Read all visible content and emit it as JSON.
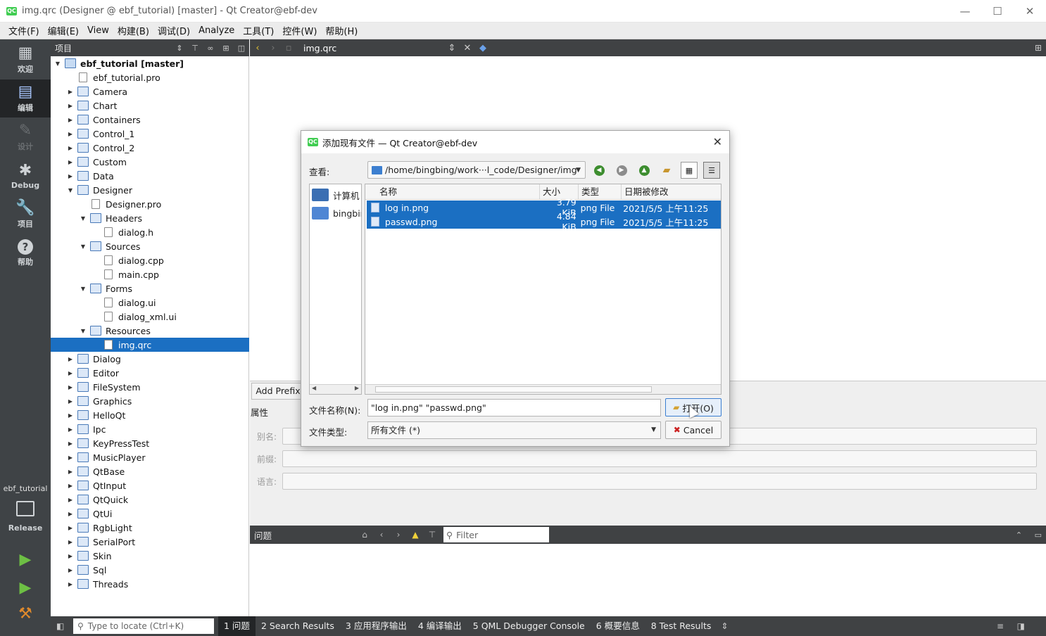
{
  "window": {
    "title": "img.qrc (Designer @ ebf_tutorial) [master] - Qt Creator@ebf-dev",
    "logo": "QC",
    "controls": [
      "minimize-icon",
      "maximize-icon",
      "close-icon"
    ]
  },
  "menu": [
    "文件(F)",
    "编辑(E)",
    "View",
    "构建(B)",
    "调试(D)",
    "Analyze",
    "工具(T)",
    "控件(W)",
    "帮助(H)"
  ],
  "modes": [
    {
      "label": "欢迎",
      "icon": "grid-icon",
      "state": "normal"
    },
    {
      "label": "编辑",
      "icon": "edit-doc-icon",
      "state": "active"
    },
    {
      "label": "设计",
      "icon": "pencil-icon",
      "state": "disabled"
    },
    {
      "label": "Debug",
      "icon": "bug-icon",
      "state": "normal"
    },
    {
      "label": "项目",
      "icon": "wrench-icon",
      "state": "normal"
    },
    {
      "label": "帮助",
      "icon": "help-icon",
      "state": "normal"
    }
  ],
  "kit": {
    "name": "ebf_tutorial",
    "build": "Release"
  },
  "project_panel": {
    "title": "项目",
    "tree": [
      {
        "label": "ebf_tutorial [master]",
        "depth": 0,
        "arrow": "open",
        "kind": "root"
      },
      {
        "label": "ebf_tutorial.pro",
        "depth": 1,
        "arrow": "none",
        "kind": "file"
      },
      {
        "label": "Camera",
        "depth": 1,
        "arrow": "closed",
        "kind": "folder"
      },
      {
        "label": "Chart",
        "depth": 1,
        "arrow": "closed",
        "kind": "folder"
      },
      {
        "label": "Containers",
        "depth": 1,
        "arrow": "closed",
        "kind": "folder"
      },
      {
        "label": "Control_1",
        "depth": 1,
        "arrow": "closed",
        "kind": "folder"
      },
      {
        "label": "Control_2",
        "depth": 1,
        "arrow": "closed",
        "kind": "folder"
      },
      {
        "label": "Custom",
        "depth": 1,
        "arrow": "closed",
        "kind": "folder"
      },
      {
        "label": "Data",
        "depth": 1,
        "arrow": "closed",
        "kind": "folder"
      },
      {
        "label": "Designer",
        "depth": 1,
        "arrow": "open",
        "kind": "folder"
      },
      {
        "label": "Designer.pro",
        "depth": 2,
        "arrow": "none",
        "kind": "file"
      },
      {
        "label": "Headers",
        "depth": 2,
        "arrow": "open",
        "kind": "folder"
      },
      {
        "label": "dialog.h",
        "depth": 3,
        "arrow": "none",
        "kind": "file"
      },
      {
        "label": "Sources",
        "depth": 2,
        "arrow": "open",
        "kind": "folder"
      },
      {
        "label": "dialog.cpp",
        "depth": 3,
        "arrow": "none",
        "kind": "file"
      },
      {
        "label": "main.cpp",
        "depth": 3,
        "arrow": "none",
        "kind": "file"
      },
      {
        "label": "Forms",
        "depth": 2,
        "arrow": "open",
        "kind": "folder"
      },
      {
        "label": "dialog.ui",
        "depth": 3,
        "arrow": "none",
        "kind": "file"
      },
      {
        "label": "dialog_xml.ui",
        "depth": 3,
        "arrow": "none",
        "kind": "file"
      },
      {
        "label": "Resources",
        "depth": 2,
        "arrow": "open",
        "kind": "folder"
      },
      {
        "label": "img.qrc",
        "depth": 3,
        "arrow": "none",
        "kind": "file",
        "selected": true
      },
      {
        "label": "Dialog",
        "depth": 1,
        "arrow": "closed",
        "kind": "folder"
      },
      {
        "label": "Editor",
        "depth": 1,
        "arrow": "closed",
        "kind": "folder"
      },
      {
        "label": "FileSystem",
        "depth": 1,
        "arrow": "closed",
        "kind": "folder"
      },
      {
        "label": "Graphics",
        "depth": 1,
        "arrow": "closed",
        "kind": "folder"
      },
      {
        "label": "HelloQt",
        "depth": 1,
        "arrow": "closed",
        "kind": "folder"
      },
      {
        "label": "Ipc",
        "depth": 1,
        "arrow": "closed",
        "kind": "folder"
      },
      {
        "label": "KeyPressTest",
        "depth": 1,
        "arrow": "closed",
        "kind": "folder"
      },
      {
        "label": "MusicPlayer",
        "depth": 1,
        "arrow": "closed",
        "kind": "folder"
      },
      {
        "label": "QtBase",
        "depth": 1,
        "arrow": "closed",
        "kind": "folder"
      },
      {
        "label": "QtInput",
        "depth": 1,
        "arrow": "closed",
        "kind": "folder"
      },
      {
        "label": "QtQuick",
        "depth": 1,
        "arrow": "closed",
        "kind": "folder"
      },
      {
        "label": "QtUi",
        "depth": 1,
        "arrow": "closed",
        "kind": "folder"
      },
      {
        "label": "RgbLight",
        "depth": 1,
        "arrow": "closed",
        "kind": "folder"
      },
      {
        "label": "SerialPort",
        "depth": 1,
        "arrow": "closed",
        "kind": "folder"
      },
      {
        "label": "Skin",
        "depth": 1,
        "arrow": "closed",
        "kind": "folder"
      },
      {
        "label": "Sql",
        "depth": 1,
        "arrow": "closed",
        "kind": "folder"
      },
      {
        "label": "Threads",
        "depth": 1,
        "arrow": "closed",
        "kind": "folder"
      }
    ]
  },
  "editor": {
    "document": "img.qrc"
  },
  "resource_editor": {
    "add_prefix": "Add Prefix",
    "properties_label": "属性",
    "fields": [
      {
        "label": "别名:",
        "value": ""
      },
      {
        "label": "前缀:",
        "value": ""
      },
      {
        "label": "语言:",
        "value": ""
      }
    ]
  },
  "issues": {
    "title": "问题",
    "filter_placeholder": "Filter"
  },
  "statusbar": {
    "locator_placeholder": "Type to locate (Ctrl+K)",
    "tabs": [
      "1 问题",
      "2 Search Results",
      "3 应用程序输出",
      "4 编译输出",
      "5 QML Debugger Console",
      "6 概要信息",
      "8 Test Results"
    ]
  },
  "dialog": {
    "title": "添加现有文件 — Qt Creator@ebf-dev",
    "look_in_label": "查看:",
    "look_in_path": "/home/bingbing/work···l_code/Designer/img",
    "sidebar": [
      "计算机",
      "bingbing"
    ],
    "columns": [
      "名称",
      "大小",
      "类型",
      "日期被修改"
    ],
    "files": [
      {
        "name": "log in.png",
        "size": "3.79 KiB",
        "type": "png File",
        "date": "2021/5/5 上午11:25"
      },
      {
        "name": "passwd.png",
        "size": "4.84 KiB",
        "type": "png File",
        "date": "2021/5/5 上午11:25"
      }
    ],
    "filename_label": "文件名称(N):",
    "filename_value": "\"log in.png\" \"passwd.png\"",
    "filetype_label": "文件类型:",
    "filetype_value": "所有文件 (*)",
    "open_button": "打开(O)",
    "cancel_button": "Cancel"
  }
}
